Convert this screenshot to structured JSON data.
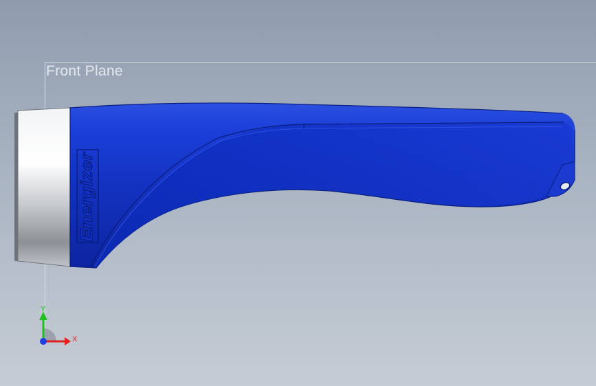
{
  "plane": {
    "label": "Front Plane"
  },
  "model": {
    "logo_text": "Energizer",
    "body_color": "#1f3fc8",
    "bezel_color": "#d9dde2"
  },
  "triad": {
    "x_label": "X",
    "y_label": "Y",
    "x_color": "#e02020",
    "y_color": "#20c020",
    "z_color": "#2040e0"
  }
}
